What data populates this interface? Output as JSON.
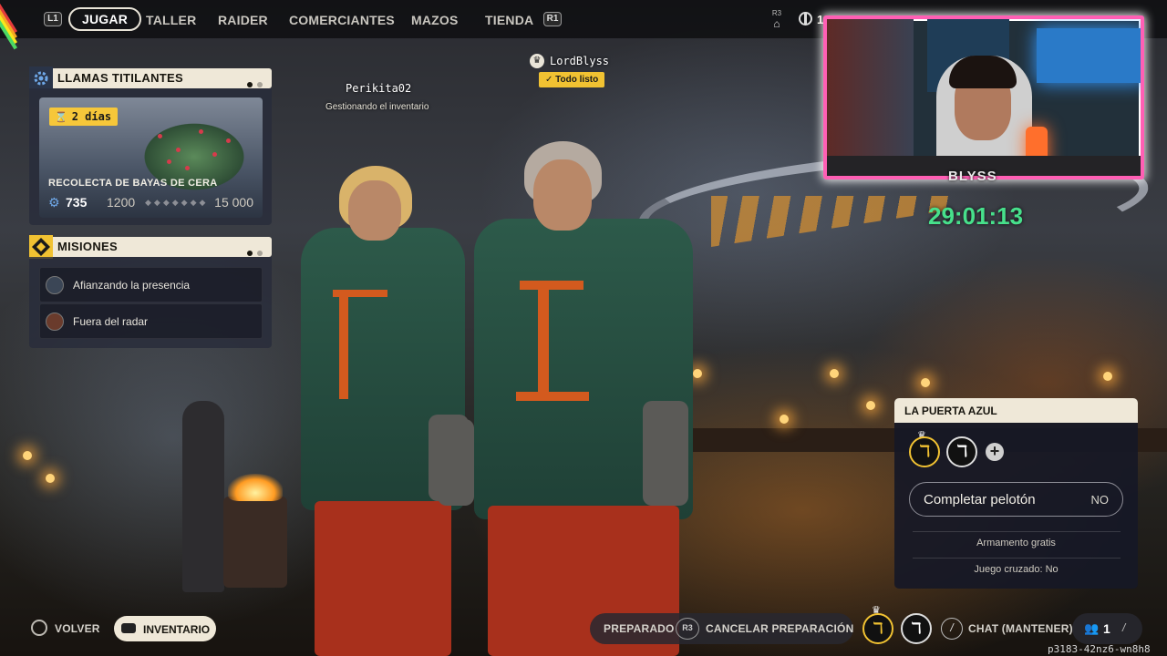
{
  "nav": {
    "left_hint": "L1",
    "right_hint": "R1",
    "tabs": [
      {
        "label": "JUGAR",
        "active": true
      },
      {
        "label": "TALLER",
        "active": false
      },
      {
        "label": "RAIDER",
        "active": false
      },
      {
        "label": "COMERCIANTES",
        "active": false
      },
      {
        "label": "MAZOS",
        "active": false
      },
      {
        "label": "TIENDA",
        "active": false
      }
    ],
    "r3_hint": "R3",
    "currency_value": "1"
  },
  "stream": {
    "cam_label": "BLYSS",
    "timer": "29:01:13",
    "frame_color": "#ff5fb4",
    "timer_color": "#47e08b"
  },
  "event_panel": {
    "title": "LLAMAS TITILANTES",
    "icon": "gear-icon",
    "time_left": "2 días",
    "event_name": "RECOLECTA DE BAYAS DE CERA",
    "current": "735",
    "milestone": "1200",
    "max": "15 000",
    "progress_fraction": 0.049,
    "dots": {
      "active": 1,
      "total": 2
    }
  },
  "missions_panel": {
    "title": "MISIONES",
    "icon": "mission-diamond-icon",
    "items": [
      {
        "label": "Afianzando la presencia",
        "icon": "mission-portrait-icon"
      },
      {
        "label": "Fuera del radar",
        "icon": "mission-portrait-icon"
      }
    ]
  },
  "players": [
    {
      "name": "Perikita02",
      "status": "Gestionando el inventario",
      "leader": false
    },
    {
      "name": "LordBlyss",
      "status": "Todo listo",
      "leader": true
    }
  ],
  "party": {
    "title": "LA PUERTA AZUL",
    "fill_label": "Completar pelotón",
    "fill_value": "NO",
    "loadout": "Armamento gratis",
    "crossplay": "Juego cruzado: No",
    "accent": "#f1c232"
  },
  "bottom": {
    "back_label": "VOLVER",
    "inventory_label": "INVENTARIO",
    "ready_label": "PREPARADO",
    "r3": "R3",
    "cancel_label": "CANCELAR PREPARACIÓN",
    "chat_label": "CHAT (MANTENER)",
    "party_count": "1",
    "session_code": "p3183-42nz6-wn8h8"
  }
}
